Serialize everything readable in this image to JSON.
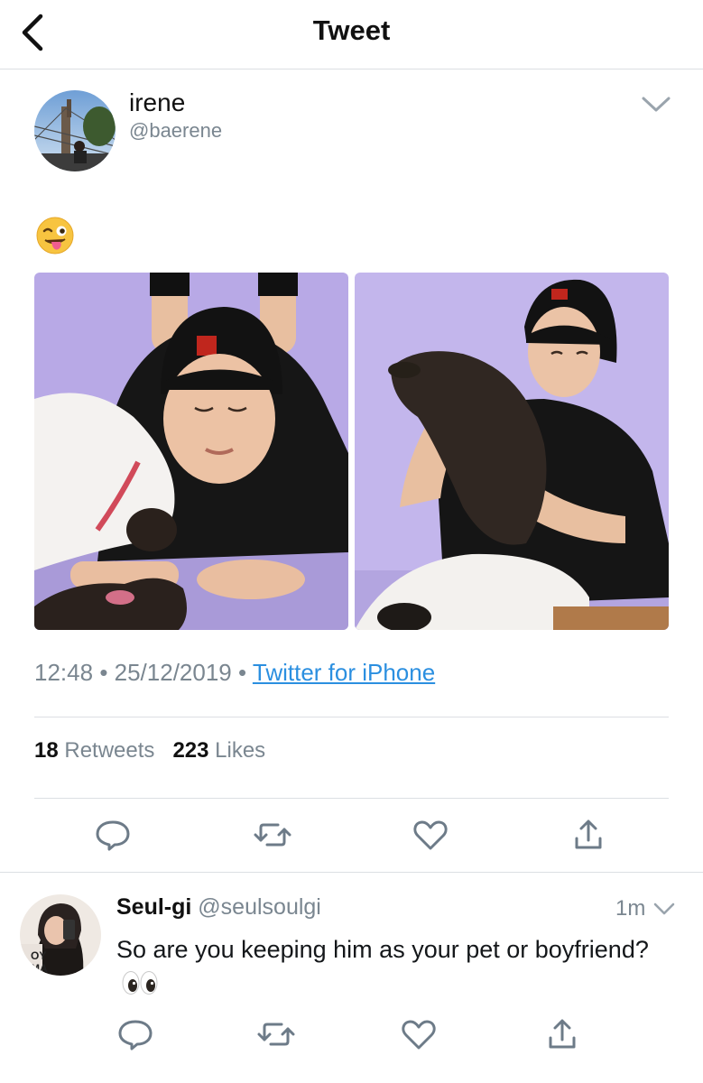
{
  "header": {
    "title": "Tweet"
  },
  "tweet": {
    "author_name": "irene",
    "author_handle": "@baerene",
    "time": "12:48",
    "date": "25/12/2019",
    "source": "Twitter for iPhone",
    "retweets_count": "18",
    "retweets_label": "Retweets",
    "likes_count": "223",
    "likes_label": "Likes"
  },
  "reply": {
    "author_name": "Seul-gi",
    "author_handle": "@seulsoulgi",
    "time": "1m",
    "text": "So are you keeping him as your pet or boyfriend?"
  },
  "icons": {
    "back": "chevron-left-icon",
    "caret": "chevron-down-icon",
    "reply": "comment-icon",
    "retweet": "retweet-icon",
    "like": "heart-icon",
    "share": "share-icon"
  },
  "colors": {
    "link": "#2b8fe0",
    "muted": "#7a8690",
    "divider": "#dcdfe3",
    "icon": "#6d7b88",
    "photo_bg": "#bcaee8"
  }
}
